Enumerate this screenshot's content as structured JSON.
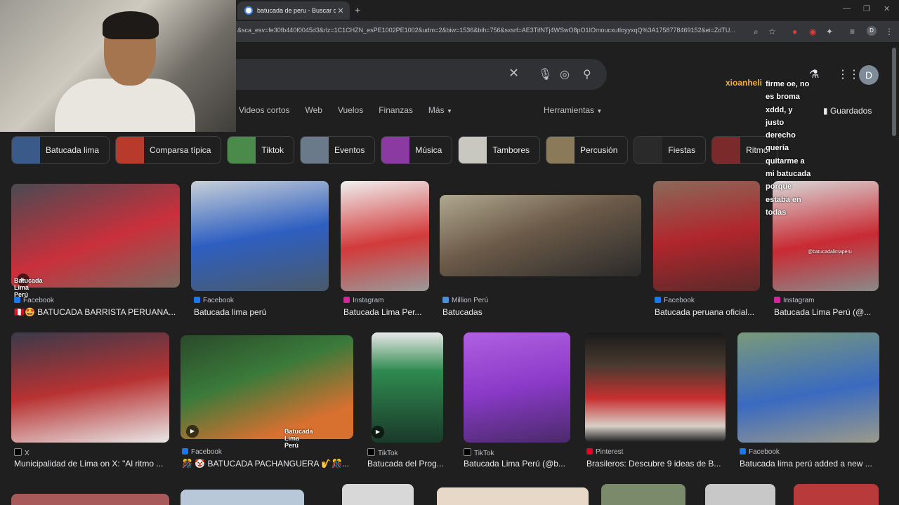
{
  "browser": {
    "tab_title": "batucada de peru - Buscar con",
    "url": "&sca_esv=fe30fb440f0045d3&rlz=1C1CHZN_esPE1002PE1002&udm=2&biw=1536&bih=756&sxsrf=AE3TifNTj4WSwO8pO1IOmoucxutloyyxqQ%3A1758778469152&ei=ZdTU...",
    "profile_letter": "D"
  },
  "search": {
    "tabs": [
      "Videos cortos",
      "Web",
      "Vuelos",
      "Finanzas",
      "Más"
    ],
    "tools": "Herramientas",
    "saved": "Guardados",
    "avatar_letter": "D"
  },
  "chips": [
    {
      "label": "Batucada lima",
      "color": "#3a5a8a"
    },
    {
      "label": "Comparsa típica",
      "color": "#b83a2a"
    },
    {
      "label": "Tiktok",
      "color": "#4a8a4a"
    },
    {
      "label": "Eventos",
      "color": "#6a7a8a"
    },
    {
      "label": "Música",
      "color": "#8a3aa0"
    },
    {
      "label": "Tambores",
      "color": "#c8c8c0"
    },
    {
      "label": "Percusión",
      "color": "#8a7a5a"
    },
    {
      "label": "Fiestas",
      "color": "#2a2a2a"
    },
    {
      "label": "Ritmo",
      "color": "#7a2a2a"
    }
  ],
  "results_row1": [
    {
      "source": "Facebook",
      "caption": "🇵🇪🤩 BATUCADA BARRISTA PERUANA...",
      "color": "#c9303b",
      "scolor": "#1877f2",
      "overlay": "Batucada Lima Perú"
    },
    {
      "source": "Facebook",
      "caption": "Batucada lima perú",
      "color": "#2e5fc1",
      "scolor": "#1877f2",
      "overlay": ""
    },
    {
      "source": "Instagram",
      "caption": "Batucada Lima Per...",
      "color": "#d23a3a",
      "scolor": "#d6249f",
      "overlay": ""
    },
    {
      "source": "Million Perú",
      "caption": "Batucadas",
      "color": "#6b5a48",
      "scolor": "#4a8fd8",
      "overlay": ""
    },
    {
      "source": "Facebook",
      "caption": "Batucada peruana oficial...",
      "color": "#b0262c",
      "scolor": "#1877f2",
      "overlay": ""
    },
    {
      "source": "Instagram",
      "caption": "Batucada Lima Perú (@...",
      "color": "#c92a33",
      "scolor": "#d6249f",
      "overlay": "@batucadalimaperu"
    }
  ],
  "results_row2": [
    {
      "source": "X",
      "caption": "Municipalidad de Lima on X: \"Al ritmo ...",
      "color": "#b83232",
      "scolor": "#000000",
      "overlay": ""
    },
    {
      "source": "Facebook",
      "caption": "🎊 🤡 BATUCADA PACHANGUERA 🎷🎊...",
      "color": "#3a7a3a",
      "scolor": "#1877f2",
      "overlay": "Batucada Lima Perú"
    },
    {
      "source": "TikTok",
      "caption": "Batucada del Prog...",
      "color": "#2f8a4f",
      "scolor": "#000000",
      "overlay": ""
    },
    {
      "source": "TikTok",
      "caption": "Batucada Lima Perú (@b...",
      "color": "#8a3ac8",
      "scolor": "#000000",
      "overlay": ""
    },
    {
      "source": "Pinterest",
      "caption": "Brasileros: Descubre 9 ideas de B...",
      "color": "#4a3a30",
      "scolor": "#e60023",
      "overlay": ""
    },
    {
      "source": "Facebook",
      "caption": "Batucada lima perú added a new ...",
      "color": "#3a6ac0",
      "scolor": "#1877f2",
      "overlay": ""
    }
  ],
  "chat": {
    "user": "xioanheli",
    "message": "firme oe, no es broma xddd, y justo derecho quería quitarme a mi batucada porque estaba en todas"
  },
  "colors": {
    "accent": "#8ab4f8",
    "chat_user": "#f2b233"
  }
}
